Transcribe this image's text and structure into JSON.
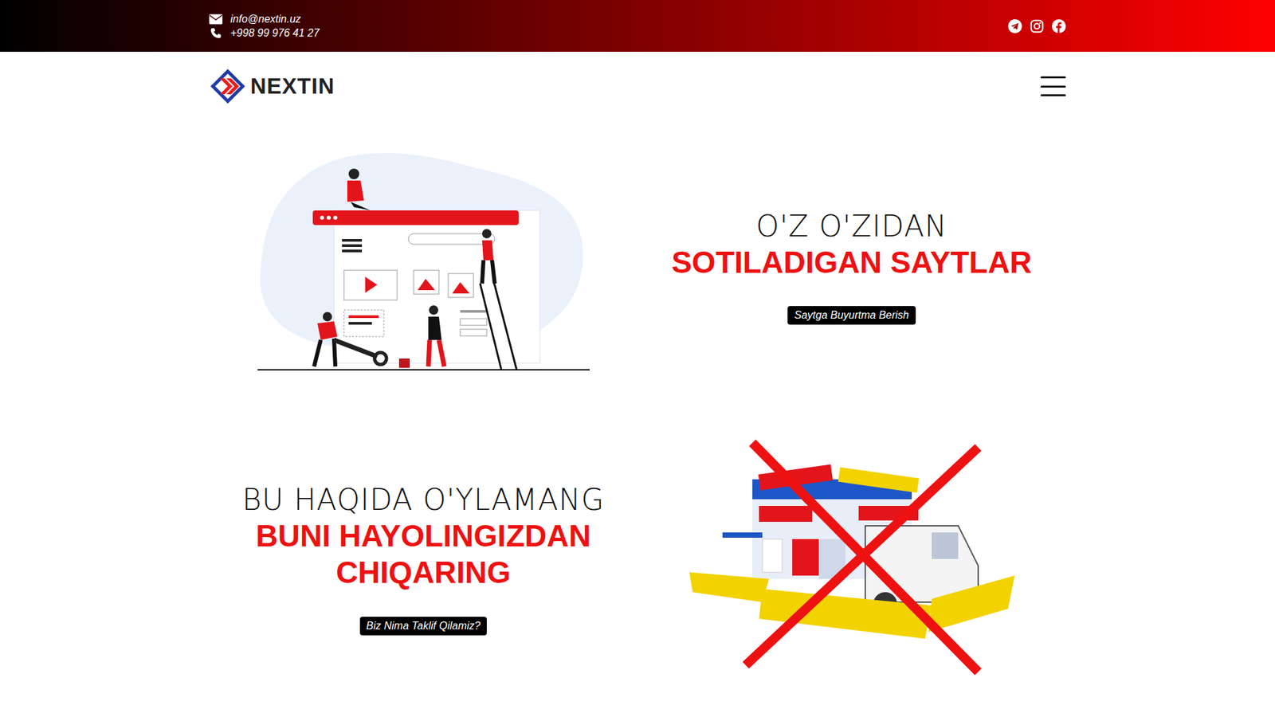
{
  "topbar": {
    "email": "info@nextin.uz",
    "phone": "+998 99 976 41 27"
  },
  "header": {
    "logo": "NEXTIN"
  },
  "hero": {
    "lines": [
      "O'Z O'ZIDAN"
    ],
    "highlight": [
      "SOTILADIGAN SAYTLAR"
    ],
    "button": "Saytga Buyurtma Berish"
  },
  "offer": {
    "lines": [
      "BU HAQIDA O'YLAMANG"
    ],
    "highlight": [
      "BUNI HAYOLINGIZDAN",
      "CHIQARING"
    ],
    "button": "Biz Nima Taklif Qilamiz?"
  }
}
